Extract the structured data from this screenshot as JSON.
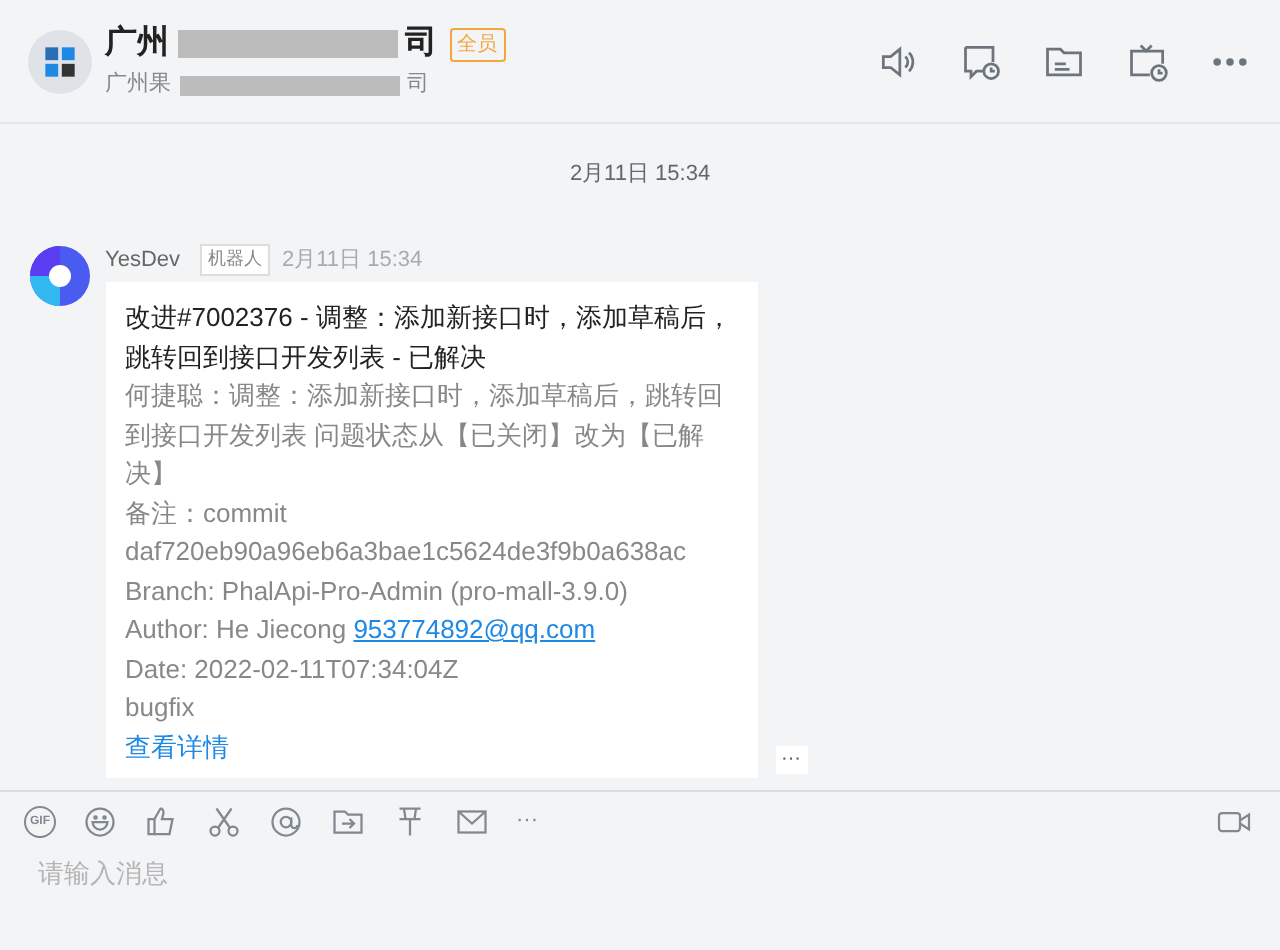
{
  "header": {
    "title_start": "广州",
    "title_end": "司",
    "subtitle_start": "广州果",
    "subtitle_end": "司",
    "badge": "全员"
  },
  "messages": [
    {
      "kind": "date",
      "text": "2月11日 15:34"
    },
    {
      "kind": "bot",
      "sender": "YesDev",
      "tag": "机器人",
      "time": "2月11日 15:34",
      "title": "改进#7002376 - 调整：添加新接口时，添加草稿后，跳转回到接口开发列表 - 已解决",
      "lines": [
        {
          "kind": "text",
          "text": "何捷聪：调整：添加新接口时，添加草稿后，跳转回到接口开发列表 问题状态从【已关闭】改为【已解决】"
        },
        {
          "kind": "text",
          "text": "备注：commit"
        },
        {
          "kind": "text",
          "text": "daf720eb90a96eb6a3bae1c5624de3f9b0a638ac"
        },
        {
          "kind": "text",
          "text": "Branch: PhalApi-Pro-Admin (pro-mall-3.9.0)"
        },
        {
          "kind": "author",
          "text": "Author: He Jiecong",
          "email": "953774892@qq.com"
        },
        {
          "kind": "text",
          "text": "Date: 2022-02-11T07:34:04Z"
        },
        {
          "kind": "text",
          "text": "bugfix"
        }
      ],
      "link": "查看详情",
      "more": "···"
    }
  ],
  "toolbar": {
    "gif_label": "GIF",
    "more": "···"
  },
  "input": {
    "placeholder": "请输入消息"
  }
}
